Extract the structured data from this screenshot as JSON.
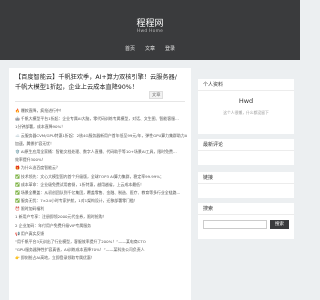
{
  "header": {
    "site_title": "程程网",
    "subtitle": "Hwd Home",
    "nav": [
      "首页",
      "文章",
      "登录"
    ]
  },
  "article": {
    "title": "【百度智能云】千帆狂欢季，AI+算力双核引擎！云服务器/千帆大模型1折起，企业上云成本直降90%！",
    "category": "文章",
    "lines": [
      {
        "icon": "🔥",
        "text": "爆款直降，疯抢进行中！"
      },
      {
        "icon": "🤖",
        "text": "千帆大模型平台1折起：企业专属AI大脑，零代码训练专属模型，对话、文生图、智能客服…"
      },
      {
        "icon": "",
        "text": "1分钟部署，成本直降90%！"
      },
      {
        "icon": "☁️",
        "text": "云服务器CVM/GPU特惠1折起：2核4G服务器新用户首年低至99元/年，弹性GPU算力集群助力AI训练…"
      },
      {
        "icon": "",
        "text": "加速，腾挪扩容无忧！"
      },
      {
        "icon": "🛡️",
        "text": "AI原生应用全家桶：智能文档处理、数字人直播、代码助手等10+场景AI工具，限时免费…"
      },
      {
        "icon": "",
        "text": "效率提升300%！"
      },
      {
        "icon": "🎁",
        "text": "为什么选百度智能云？"
      },
      {
        "icon": "✅",
        "text": "技术领先：文心大模型国内首个升级版，全球TOP3 AI算力集群，稳定率99.99%；"
      },
      {
        "icon": "✅",
        "text": "成本革命：企业级免费试用套餐，1折特惠，越用越省，上云成本最低！"
      },
      {
        "icon": "✅",
        "text": "场景全覆盖：从初创团队到千亿集团，覆盖零售、金融、制造、医疗、教育等多行业全链路…"
      },
      {
        "icon": "✅",
        "text": "服务无忧：7×24小时专家护航，1对1架构设计，迁移部署零门槛！"
      },
      {
        "icon": "⏰",
        "text": "限时加码福利"
      },
      {
        "icon": "",
        "text": "1 新用户专享：注册即领2000元代金券，限时抢购！"
      },
      {
        "icon": "",
        "text": "2 企业加码：年付用户免费升级VIP专属服务"
      },
      {
        "icon": "📢",
        "text": "用户真实反馈"
      },
      {
        "icon": "",
        "text": "“用千帆平台3天训出了行业模型，客服效率提升了200%！”——某电商CTO"
      },
      {
        "icon": "",
        "text": "“GPU服务器弹性扩容真香，AI训练成本直降70%！”——某科技公司负责人"
      },
      {
        "icon": "👉",
        "text": "即刻抢占AI高地，立即登录领取专属优惠！"
      }
    ]
  },
  "sidebar": {
    "profile": {
      "heading": "个人资料",
      "name": "Hwd",
      "desc": "这个人很懒，什么都没留下"
    },
    "comments": {
      "heading": "最新评论"
    },
    "links": {
      "heading": "链接"
    },
    "search": {
      "heading": "搜索",
      "placeholder": "",
      "button": "搜索"
    }
  },
  "colors": {
    "header_bg": "#3a3b3d",
    "page_bg": "#eceff1",
    "card_bg": "#ffffff"
  }
}
